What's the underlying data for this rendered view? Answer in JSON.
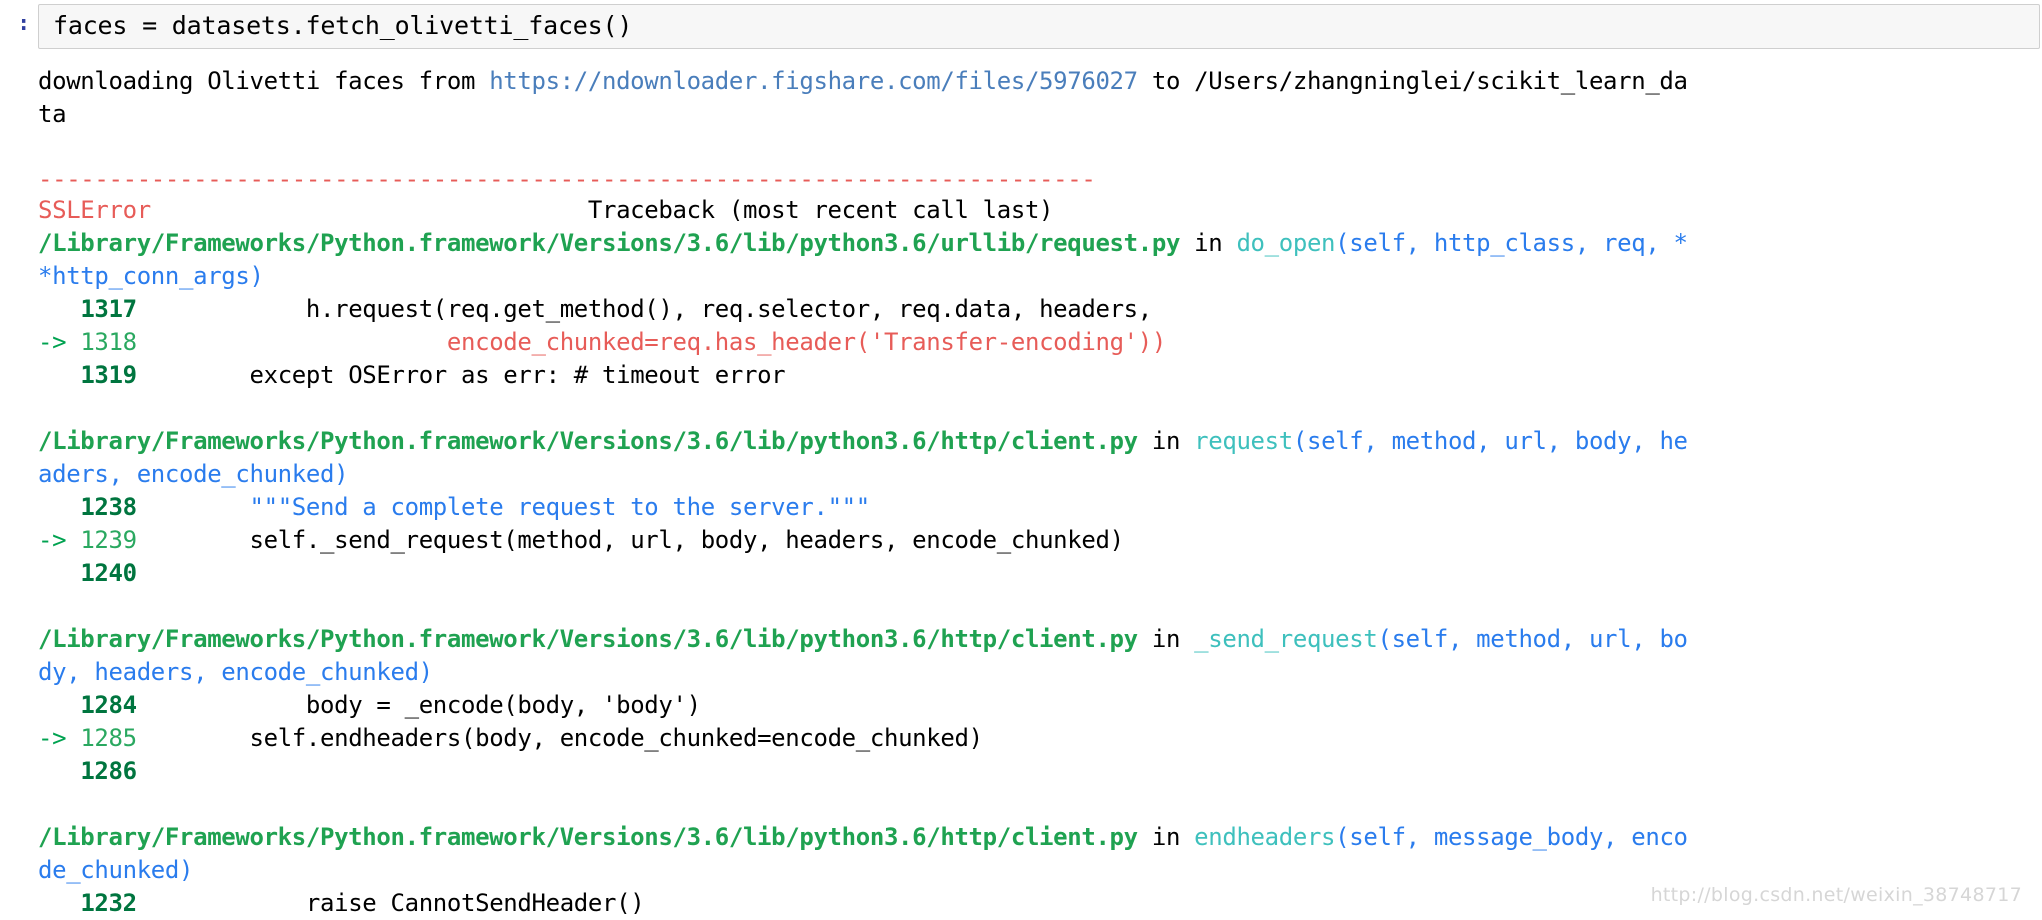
{
  "cell": {
    "prompt": ":",
    "input_code": "faces = datasets.fetch_olivetti_faces()"
  },
  "output": {
    "download_message": {
      "prefix": "downloading Olivetti faces from ",
      "url": "https://ndownloader.figshare.com/files/5976027",
      "suffix": " to /Users/zhangninglei/scikit_learn_da",
      "wrap": "ta"
    },
    "separator": "---------------------------------------------------------------------------",
    "error_header": {
      "exception": "SSLError",
      "traceback_label": "Traceback (most recent call last)"
    },
    "frames": [
      {
        "path": "/Library/Frameworks/Python.framework/Versions/3.6/lib/python3.6/urllib/request.py",
        "in_keyword": " in ",
        "function": "do_open",
        "signature_open": "(",
        "signature_args": "self, http_class, req, *",
        "signature_wrap": "*http_conn_args)",
        "lines": [
          {
            "marker": "   ",
            "number": "1317",
            "current": false,
            "code": "            h.request(req.get_method(), req.selector, req.data, headers,"
          },
          {
            "marker": "-> ",
            "number": "1318",
            "current": true,
            "code": "                      encode_chunked=req.has_header('Transfer-encoding'))"
          },
          {
            "marker": "   ",
            "number": "1319",
            "current": false,
            "code": "        except OSError as err: # timeout error"
          }
        ]
      },
      {
        "path": "/Library/Frameworks/Python.framework/Versions/3.6/lib/python3.6/http/client.py",
        "in_keyword": " in ",
        "function": "request",
        "signature_open": "(",
        "signature_args": "self, method, url, body, he",
        "signature_wrap": "aders, encode_chunked)",
        "lines": [
          {
            "marker": "   ",
            "number": "1238",
            "current": false,
            "code": "        \"\"\"Send a complete request to the server.\"\"\""
          },
          {
            "marker": "-> ",
            "number": "1239",
            "current": true,
            "code": "        self._send_request(method, url, body, headers, encode_chunked)"
          },
          {
            "marker": "   ",
            "number": "1240",
            "current": false,
            "code": ""
          }
        ]
      },
      {
        "path": "/Library/Frameworks/Python.framework/Versions/3.6/lib/python3.6/http/client.py",
        "in_keyword": " in ",
        "function": "_send_request",
        "signature_open": "(",
        "signature_args": "self, method, url, bo",
        "signature_wrap": "dy, headers, encode_chunked)",
        "lines": [
          {
            "marker": "   ",
            "number": "1284",
            "current": false,
            "code": "            body = _encode(body, 'body')"
          },
          {
            "marker": "-> ",
            "number": "1285",
            "current": true,
            "code": "        self.endheaders(body, encode_chunked=encode_chunked)"
          },
          {
            "marker": "   ",
            "number": "1286",
            "current": false,
            "code": ""
          }
        ]
      },
      {
        "path": "/Library/Frameworks/Python.framework/Versions/3.6/lib/python3.6/http/client.py",
        "in_keyword": " in ",
        "function": "endheaders",
        "signature_open": "(",
        "signature_args": "self, message_body, enco",
        "signature_wrap": "de_chunked)",
        "lines": [
          {
            "marker": "   ",
            "number": "1232",
            "current": false,
            "code": "            raise CannotSendHeader()"
          }
        ]
      }
    ]
  },
  "watermark": "http://blog.csdn.net/weixin_38748717",
  "colors": {
    "path_green": "#1fa251",
    "function_teal": "#3ec0bd",
    "arg_blue": "#2a7ced",
    "error_red": "#e75c58",
    "lineno_green": "#00753f",
    "url_blue": "#4a7ebb",
    "prompt_blue": "#303F9F",
    "input_bg": "#f7f7f7",
    "input_border": "#cfcfcf"
  }
}
